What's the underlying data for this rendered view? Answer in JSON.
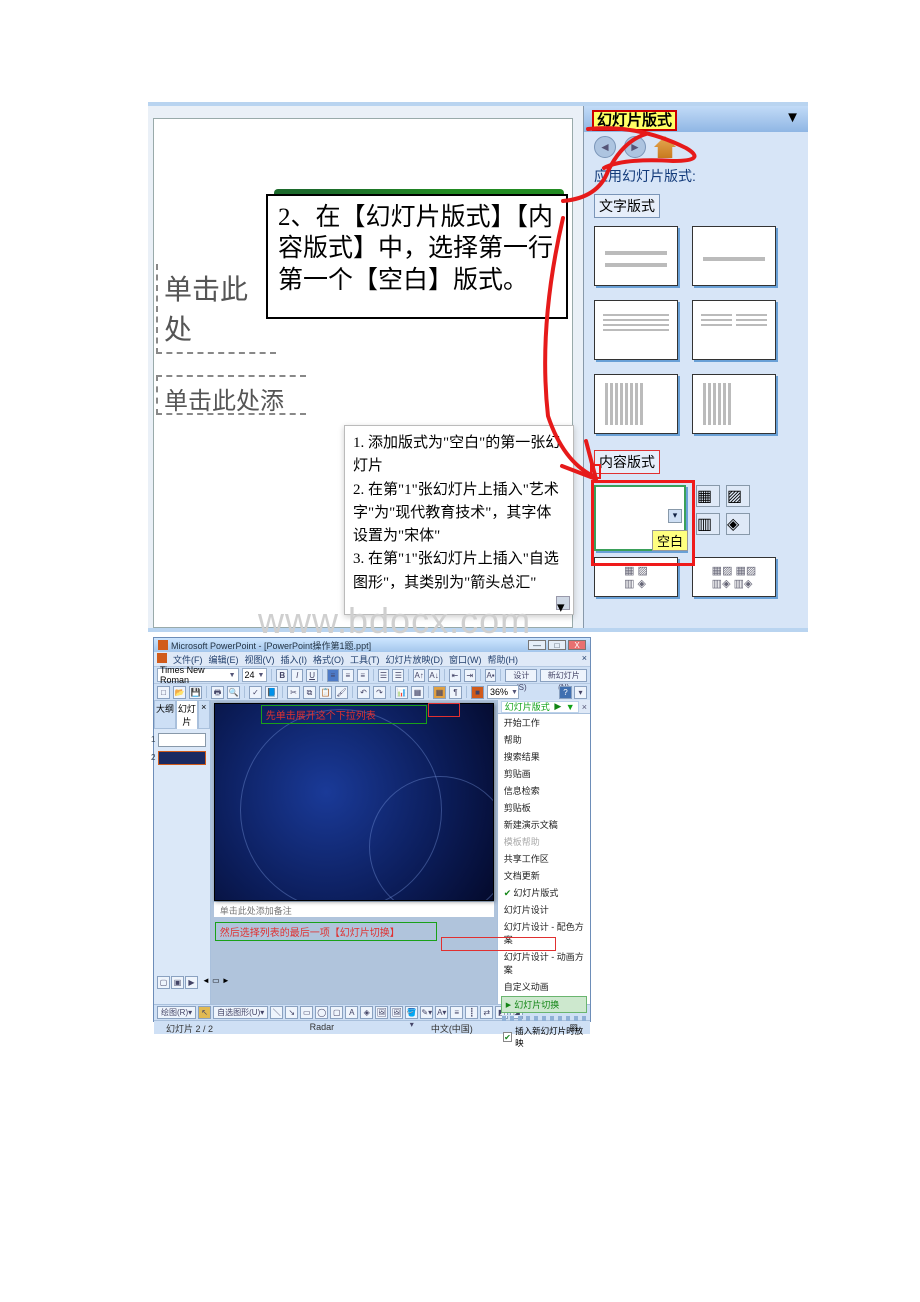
{
  "page": {
    "watermark": "www.bdocx.com"
  },
  "top_ss": {
    "placeholder1": "单击此处",
    "placeholder2": "单击此处添",
    "callout_main": "2、在【幻灯片版式】【内容版式】中，选择第一行第一个【空白】版式。",
    "instructions": {
      "l1": "1. 添加版式为\"空白\"的第一张幻灯片",
      "l2": "2. 在第\"1\"张幻灯片上插入\"艺术字\"为\"现代教育技术\"，其字体设置为\"宋体\"",
      "l3": "3. 在第\"1\"张幻灯片上插入\"自选图形\"，其类别为\"箭头总汇\""
    },
    "task_pane": {
      "title": "幻灯片版式",
      "apply_label": "应用幻灯片版式:",
      "section_text": "文字版式",
      "section_content": "内容版式",
      "blank_label": "空白"
    }
  },
  "bottom_ss": {
    "title": "Microsoft PowerPoint - [PowerPoint操作第1题.ppt]",
    "menu": {
      "file": "文件(F)",
      "edit": "编辑(E)",
      "view": "视图(V)",
      "insert": "插入(I)",
      "format": "格式(O)",
      "tools": "工具(T)",
      "slideshow": "幻灯片放映(D)",
      "window": "窗口(W)",
      "help": "帮助(H)"
    },
    "toolbar": {
      "font_name": "Times New Roman",
      "font_size": "24",
      "design_btn": "设计(S)",
      "new_slide": "新幻灯片(N)",
      "zoom": "36%"
    },
    "sidebar": {
      "tab_outline": "大纲",
      "tab_slides": "幻灯片"
    },
    "callout_top": "先单击展开这个下拉列表",
    "callout_bottom": "然后选择列表的最后一项【幻灯片切换】",
    "right_tools": {
      "combo": "幻灯片版式",
      "items": {
        "start": "开始工作",
        "help": "帮助",
        "search": "搜索结果",
        "clipart": "剪贴画",
        "research": "信息检索",
        "clipboard": "剪贴板",
        "newpres": "新建演示文稿",
        "tmplhelp": "模板帮助",
        "shared": "共享工作区",
        "docupdate": "文档更新",
        "layout": "幻灯片版式",
        "design": "幻灯片设计",
        "design_color": "幻灯片设计 - 配色方案",
        "design_anim": "幻灯片设计 - 动画方案",
        "custom_anim": "自定义动画",
        "transition": "幻灯片切换"
      },
      "checkbox": "插入新幻灯片时放映"
    },
    "notes": "单击此处添加备注",
    "draw_label": "绘图(R)",
    "shapes_label": "自选图形(U)",
    "status": {
      "slide_no": "幻灯片 2 / 2",
      "template": "Radar",
      "lang": "中文(中国)"
    }
  }
}
